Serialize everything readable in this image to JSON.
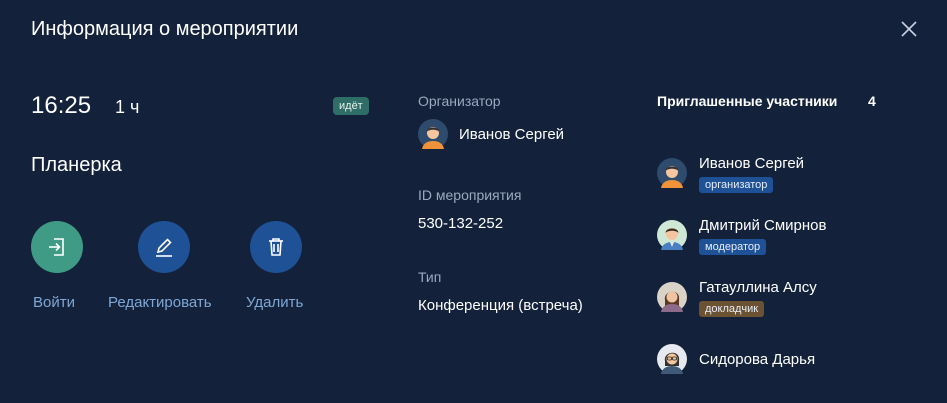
{
  "dialog": {
    "title": "Информация о мероприятии"
  },
  "event": {
    "time": "16:25",
    "duration": "1 ч",
    "status": "идёт",
    "name": "Планерка"
  },
  "actions": {
    "join_label": "Войти",
    "edit_label": "Редактировать",
    "delete_label": "Удалить"
  },
  "details": {
    "organizer_label": "Организатор",
    "organizer_name": "Иванов Сергей",
    "id_label": "ID мероприятия",
    "id_value": "530-132-252",
    "type_label": "Тип",
    "type_value": "Конференция (встреча)"
  },
  "participants": {
    "title": "Приглашенные участники",
    "count": "4",
    "items": [
      {
        "name": "Иванов Сергей",
        "role": "организатор"
      },
      {
        "name": "Дмитрий Смирнов",
        "role": "модератор"
      },
      {
        "name": "Гатауллина Алсу",
        "role": "докладчик"
      },
      {
        "name": "Сидорова Дарья",
        "role": ""
      }
    ]
  },
  "colors": {
    "background": "#13223a",
    "join_button": "#3f9b86",
    "action_button": "#1f5196",
    "link_text": "#7fa7d6",
    "status_badge": "#2f6e66",
    "role_speaker": "#6b5232"
  },
  "icons": {
    "close": "close-icon",
    "join": "enter-icon",
    "edit": "pencil-icon",
    "delete": "trash-icon"
  }
}
